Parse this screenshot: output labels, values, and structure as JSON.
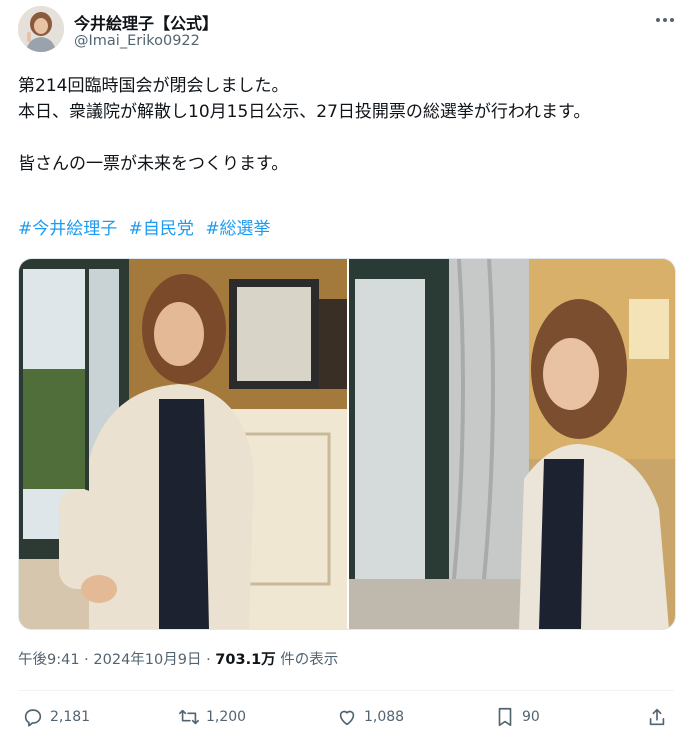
{
  "author": {
    "name": "今井絵理子【公式】",
    "handle": "@Imai_Eriko0922"
  },
  "post": {
    "line1": "第214回臨時国会が閉会しました。",
    "line2": "本日、衆議院が解散し10月15日公示、27日投開票の総選挙が行われます。",
    "line3": "皆さんの一票が未来をつくります。",
    "hashtags": [
      "#今井絵理子",
      "#自民党",
      "#総選挙"
    ]
  },
  "meta": {
    "time": "午後9:41",
    "separator1": "·",
    "date": "2024年10月9日",
    "separator2": "·",
    "views": "703.1万",
    "views_label": "件の表示"
  },
  "actions": {
    "replies": "2,181",
    "reposts": "1,200",
    "likes": "1,088",
    "bookmarks": "90"
  },
  "colors": {
    "accent": "#1d9bf0",
    "secondary_text": "#536471",
    "primary_text": "#0f1419"
  },
  "icons": [
    "more-icon",
    "reply-icon",
    "repost-icon",
    "like-icon",
    "bookmark-icon",
    "share-icon"
  ]
}
